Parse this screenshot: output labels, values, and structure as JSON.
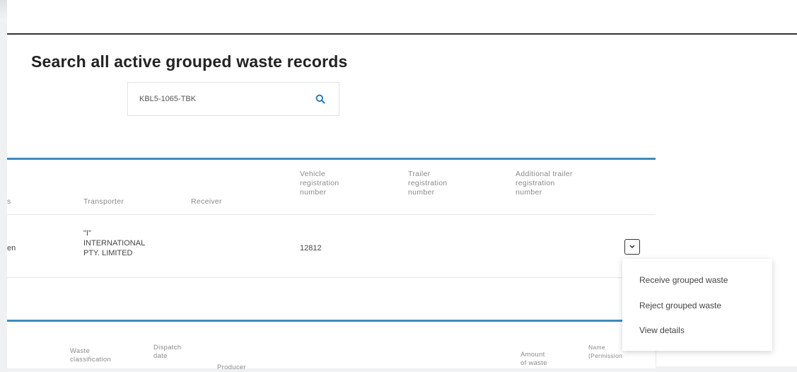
{
  "page_title": "Search all active grouped waste records",
  "search": {
    "value": "KBL5-1065-TBK",
    "icon": "search-icon",
    "accent": "#2a7bbf"
  },
  "records_table": {
    "accent": "#3c8dbc",
    "headers": {
      "partial": "s",
      "transporter": "Transporter",
      "receiver": "Receiver",
      "vehicle": [
        "Vehicle",
        "registration",
        "number"
      ],
      "trailer": [
        "Trailer",
        "registration",
        "number"
      ],
      "additional": [
        "Additional trailer",
        "registration",
        "number"
      ]
    },
    "row": {
      "partial_status": "en",
      "transporter": [
        "\"I\"",
        "INTERNATIONAL",
        "PTY. LIMITED"
      ],
      "receiver": "",
      "vehicle": "12812",
      "trailer": "",
      "additional": ""
    }
  },
  "actions_menu": {
    "items": [
      "Receive grouped waste",
      "Reject grouped waste",
      "View details"
    ]
  },
  "details_table": {
    "headers": {
      "waste": [
        "Waste",
        "classification"
      ],
      "dispatch": [
        "Dispatch",
        "date"
      ],
      "producer": "Producer",
      "amount": [
        "Amount",
        "of waste"
      ],
      "name": [
        "Name",
        "(Permission"
      ]
    }
  }
}
